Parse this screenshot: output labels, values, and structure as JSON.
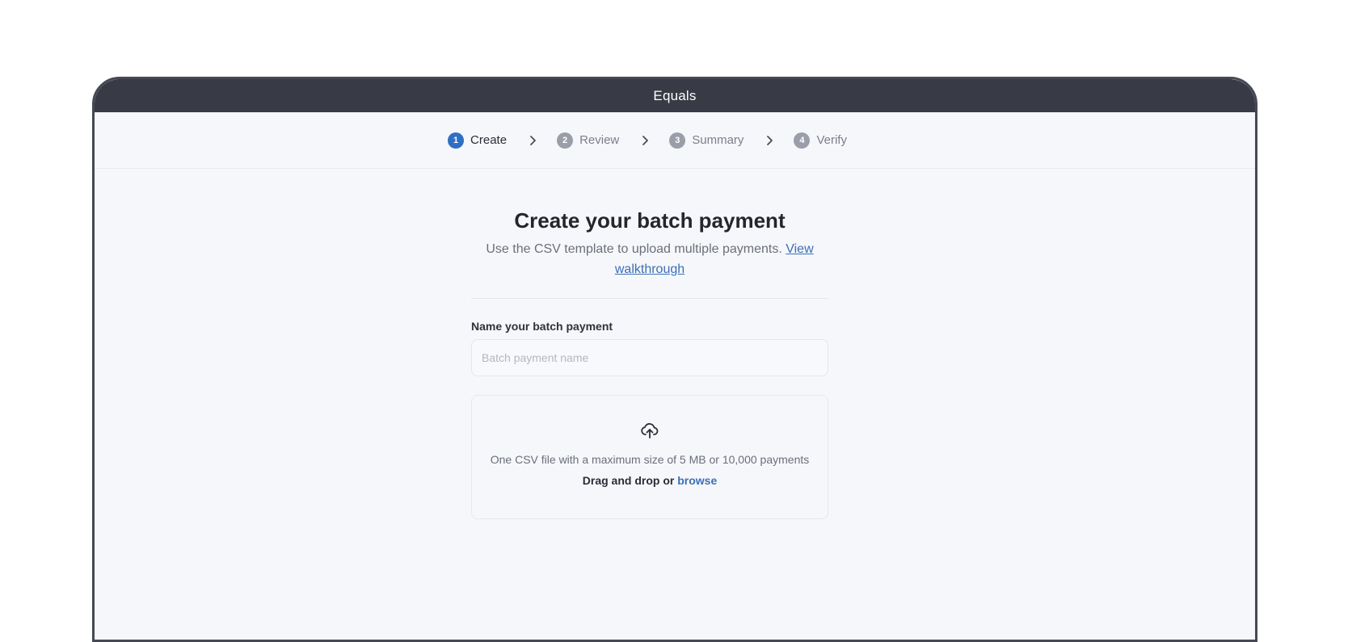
{
  "window": {
    "title": "Equals"
  },
  "stepper": {
    "steps": [
      {
        "number": "1",
        "label": "Create"
      },
      {
        "number": "2",
        "label": "Review"
      },
      {
        "number": "3",
        "label": "Summary"
      },
      {
        "number": "4",
        "label": "Verify"
      }
    ],
    "active_step": "1"
  },
  "page": {
    "title": "Create your batch payment",
    "subtitle": "Use the CSV template to upload multiple payments.",
    "walkthrough_link": "View walkthrough"
  },
  "form": {
    "name_label": "Name your batch payment",
    "name_placeholder": "Batch payment name",
    "name_value": ""
  },
  "upload": {
    "icon": "cloud-upload-icon",
    "limit_text": "One CSV file with a maximum size of 5 MB or 10,000 payments",
    "drag_text": "Drag and drop or",
    "browse_link": "browse"
  },
  "colors": {
    "titlebar": "#383b45",
    "accent": "#2f6ec2",
    "link": "#3b6fb6",
    "inactive_step": "#9a9ea8",
    "background": "#f6f7fb"
  }
}
